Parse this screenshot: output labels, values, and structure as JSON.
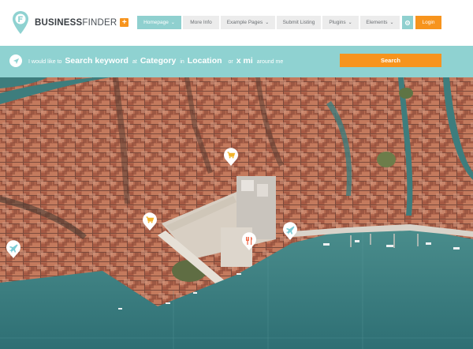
{
  "brand": {
    "name_bold": "BUSINESS",
    "name_thin": "FINDER",
    "plus": "+"
  },
  "nav": {
    "items": [
      {
        "label": "Homepage",
        "dropdown": true,
        "active": true
      },
      {
        "label": "More Info",
        "dropdown": false,
        "active": false
      },
      {
        "label": "Example Pages",
        "dropdown": true,
        "active": false
      },
      {
        "label": "Submit Listing",
        "dropdown": false,
        "active": false
      },
      {
        "label": "Plugins",
        "dropdown": true,
        "active": false
      },
      {
        "label": "Elements",
        "dropdown": true,
        "active": false
      }
    ],
    "settings_icon": "gear-icon",
    "login_label": "Login"
  },
  "search": {
    "prefix": "I would like to",
    "keyword": "Search keyword",
    "at": "at",
    "category": "Category",
    "in": "in",
    "location": "Location",
    "or": "or",
    "distance": "x mi",
    "around": "around me",
    "button_label": "Search",
    "locate_icon": "location-arrow-icon"
  },
  "map": {
    "markers": [
      {
        "icon": "shopping-cart-icon"
      },
      {
        "icon": "shopping-cart-icon"
      },
      {
        "icon": "airplane-icon"
      },
      {
        "icon": "restaurant-icon"
      },
      {
        "icon": "airplane-icon"
      }
    ]
  },
  "colors": {
    "teal": "#8fd2d1",
    "orange": "#f7941d",
    "nav_bg": "#ececec",
    "water": "#3d7f80",
    "roof": "#b86c52"
  }
}
